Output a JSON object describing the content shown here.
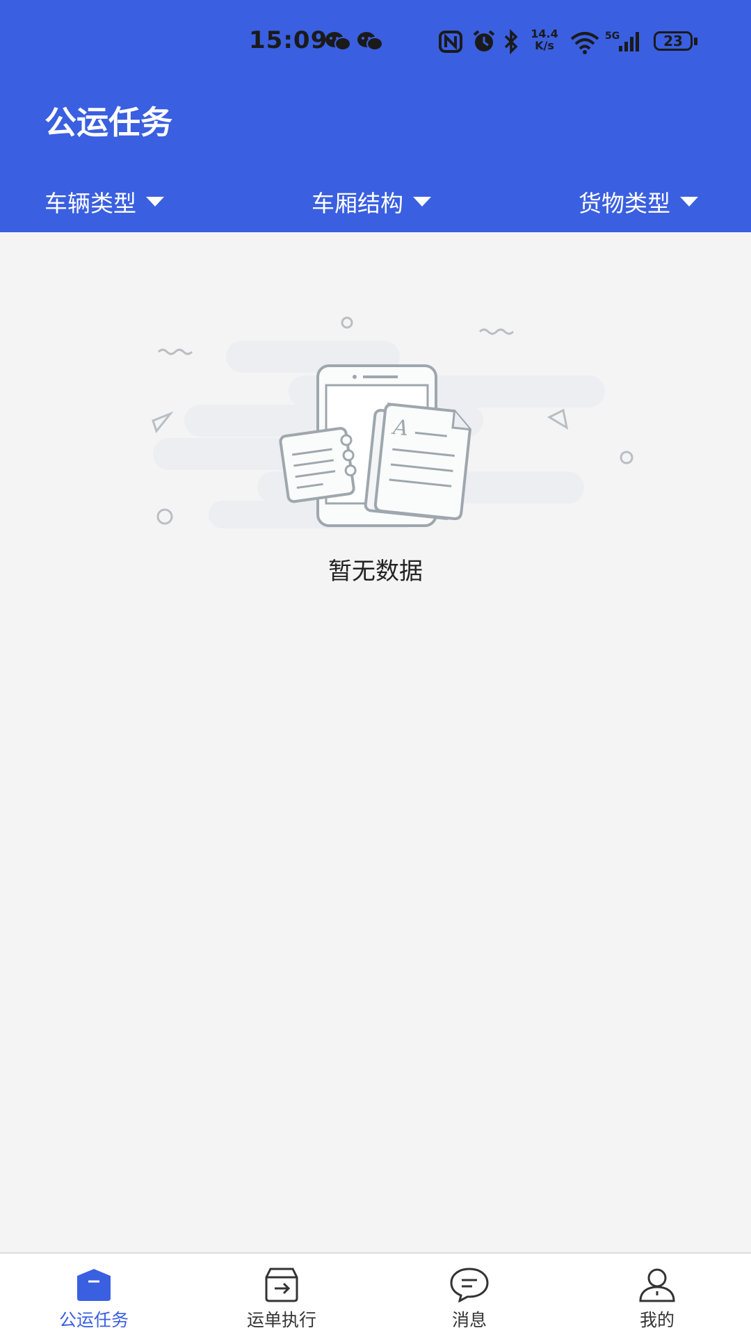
{
  "status_bar": {
    "time": "15:09",
    "network_speed": "14.4\nK/s",
    "network_speed_value": "14.4",
    "network_speed_unit": "K/s",
    "network_type": "5G",
    "battery": "23",
    "icons": [
      "wechat-icon",
      "wechat-icon",
      "nfc-icon",
      "alarm-icon",
      "bluetooth-icon",
      "wifi-icon",
      "signal-icon",
      "battery-icon"
    ]
  },
  "header": {
    "title": "公运任务",
    "filters": [
      {
        "label": "车辆类型"
      },
      {
        "label": "车厢结构"
      },
      {
        "label": "货物类型"
      }
    ],
    "color": "#3a5fe0"
  },
  "empty_state": {
    "message": "暂无数据",
    "illustration": "empty-documents-illustration"
  },
  "tabbar": {
    "tabs": [
      {
        "label": "公运任务",
        "icon": "task-folder-icon",
        "active": true
      },
      {
        "label": "运单执行",
        "icon": "waybill-icon",
        "active": false
      },
      {
        "label": "消息",
        "icon": "message-bubble-icon",
        "active": false
      },
      {
        "label": "我的",
        "icon": "profile-icon",
        "active": false
      }
    ],
    "active_color": "#3a5fe0"
  }
}
